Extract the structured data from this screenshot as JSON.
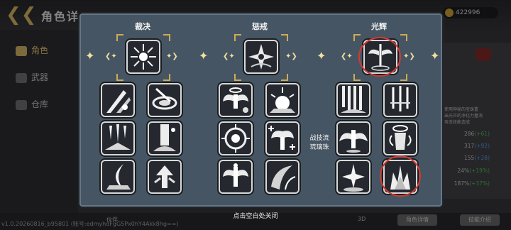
{
  "background": {
    "title": "角色详",
    "gold": "422996",
    "sidebar": [
      {
        "label": "角色",
        "active": true
      },
      {
        "label": "武器",
        "active": false
      },
      {
        "label": "仓库",
        "active": false
      }
    ],
    "desc_lines": [
      "使用神秘的宝珠重",
      "出光芒的净化力量消",
      "攻击技能造成"
    ],
    "stats": [
      {
        "value": "286",
        "delta": "(+61)",
        "tone": "green"
      },
      {
        "value": "317",
        "delta": "(+92)",
        "tone": "blue"
      },
      {
        "value": "155",
        "delta": "(+28)",
        "tone": "blue"
      },
      {
        "value": "24%",
        "delta": "(+19%)",
        "tone": "green"
      },
      {
        "value": "187%",
        "delta": "(+37%)",
        "tone": "green"
      }
    ],
    "version": "v1.0.20260816_b95801 (账号:edmyhdFgG5Px0hY4Akk8hg==)",
    "bottom_left_label": "伙伴",
    "bottom_mid_label": "3D",
    "button_a": "角色详情",
    "button_b": "技能介绍"
  },
  "panel": {
    "columns": [
      {
        "title": "裁决",
        "top_icon": "radiant-burst-icon",
        "skills": [
          "blade-storm-icon",
          "vortex-slash-icon",
          "spike-shower-icon",
          "pillar-strike-icon",
          "crescent-wing-icon",
          "arrow-up-icon"
        ]
      },
      {
        "title": "惩戒",
        "top_icon": "compass-star-icon",
        "skills": [
          "angel-halo-icon",
          "sun-burst-icon",
          "sun-ring-icon",
          "winged-plus-icon",
          "angel-light-icon",
          "dark-wing-icon"
        ]
      },
      {
        "title": "光辉",
        "top_icon": "winged-sword-icon",
        "skills": [
          "light-fall-icon",
          "triple-sword-icon",
          "winged-angel-icon",
          "angel-ring-icon",
          "light-burst-icon",
          "flame-crystal-icon"
        ]
      }
    ],
    "side_text": [
      "战技流",
      "琉璃珠"
    ],
    "close_hint": "点击空白处关闭"
  }
}
